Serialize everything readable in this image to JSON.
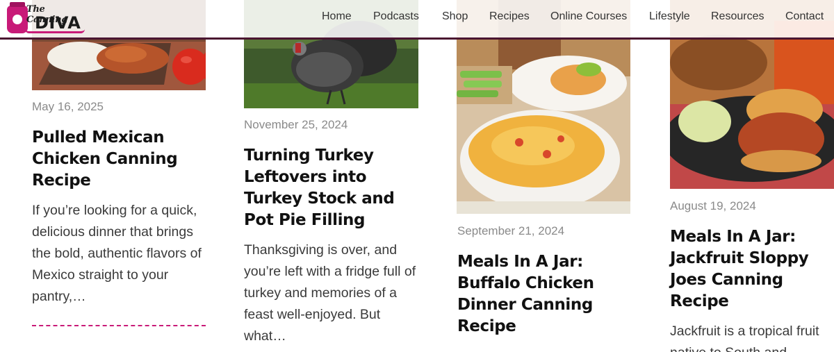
{
  "brand": {
    "logo_top": "The Canning",
    "logo_main": "DIVA"
  },
  "nav": {
    "items": [
      "Home",
      "Podcasts",
      "Shop",
      "Recipes",
      "Online Courses",
      "Lifestyle",
      "Resources",
      "Contact"
    ]
  },
  "posts": [
    {
      "date": "May 16, 2025",
      "title": "Pulled Mexican Chicken Canning Recipe",
      "excerpt": "If you’re looking for a quick, delicious dinner that brings the bold, authentic flavors of Mexico straight to your pantry,…"
    },
    {
      "date": "November 25, 2024",
      "title": "Turning Turkey Leftovers into Turkey Stock and Pot Pie Filling",
      "excerpt": "Thanksgiving is over, and you’re left with a fridge full of turkey and memories of a feast well-enjoyed. But what…"
    },
    {
      "date": "September 21, 2024",
      "title": "Meals In A Jar: Buffalo Chicken Dinner Canning Recipe",
      "excerpt": ""
    },
    {
      "date": "August 19, 2024",
      "title": "Meals In A Jar: Jackfruit Sloppy Joes Canning Recipe",
      "excerpt": "Jackfruit is a tropical fruit native to South and"
    }
  ],
  "colors": {
    "accent": "#c81a78",
    "header_border": "#4a1530"
  }
}
